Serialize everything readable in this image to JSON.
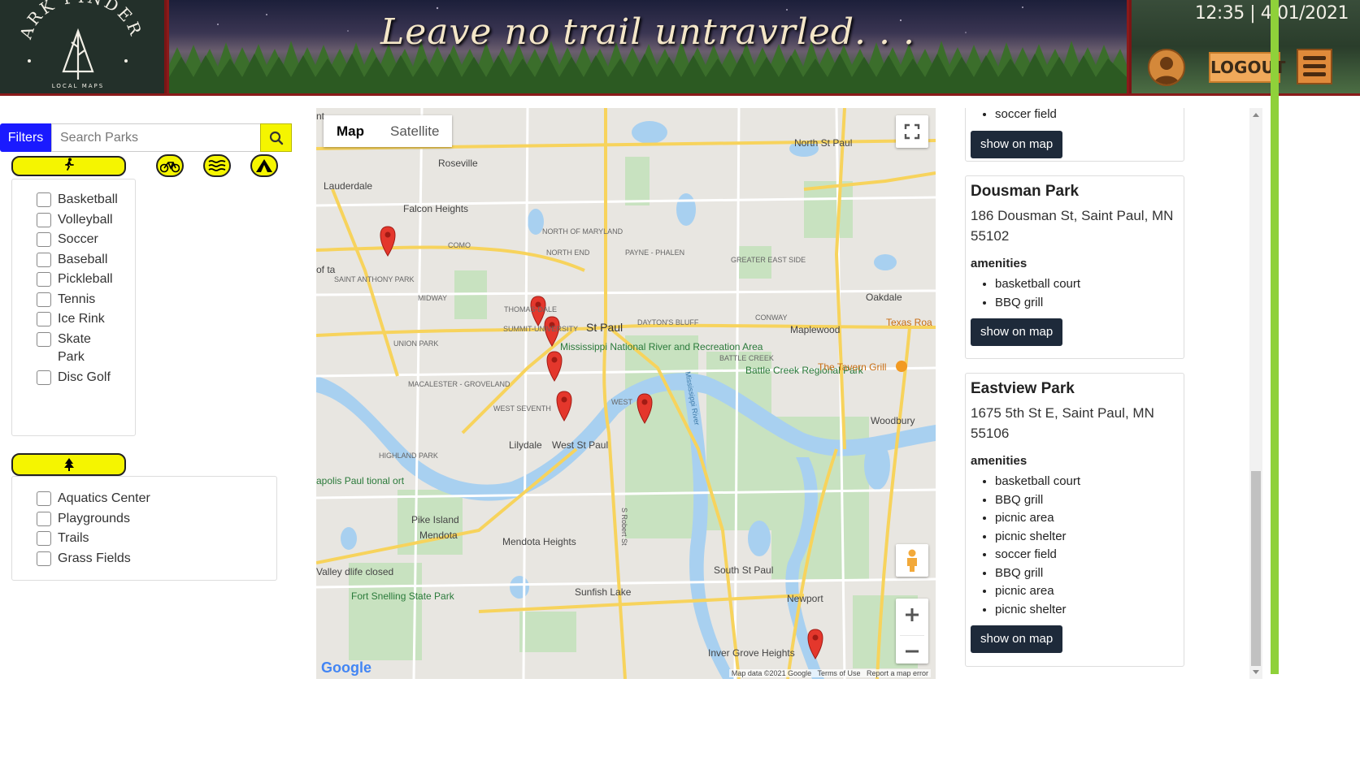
{
  "header": {
    "logo": {
      "title": "PARK FINDERS",
      "subtitle": "LOCAL MAPS",
      "icon": "tree-icon"
    },
    "tagline": "Leave no trail untravrled. . .",
    "clock": "12:35 | 4/01/2021",
    "logout_label": "LOGOUT",
    "avatar_icon": "user-avatar-icon",
    "menu_icon": "hamburger-menu-icon"
  },
  "sidebar": {
    "filters_label": "Filters",
    "search_placeholder": "Search Parks",
    "category_icons": [
      "walking-person-icon",
      "bicycle-icon",
      "water-waves-icon",
      "tent-icon",
      "pine-tree-icon"
    ],
    "sports": [
      {
        "label": "Basketball"
      },
      {
        "label": "Volleyball"
      },
      {
        "label": "Soccer"
      },
      {
        "label": "Baseball"
      },
      {
        "label": "Pickleball"
      },
      {
        "label": "Tennis"
      },
      {
        "label": "Ice Rink"
      },
      {
        "label": "Skate Park"
      },
      {
        "label": "Disc Golf"
      }
    ],
    "facilities": [
      {
        "label": "Aquatics Center"
      },
      {
        "label": "Playgrounds"
      },
      {
        "label": "Trails"
      },
      {
        "label": "Grass Fields"
      }
    ]
  },
  "map": {
    "type_map": "Map",
    "type_satellite": "Satellite",
    "attribution": "Map data ©2021 Google",
    "terms": "Terms of Use",
    "report": "Report a map error",
    "google": "Google",
    "places": {
      "roseville": "Roseville",
      "lauderdale": "Lauderdale",
      "falcon": "Falcon Heights",
      "como": "COMO",
      "north_maryland": "NORTH OF MARYLAND",
      "north_end": "NORTH END",
      "payne": "PAYNE - PHALEN",
      "greater_east": "GREATER EAST SIDE",
      "north_st_paul": "North St Paul",
      "oakdale": "Oakdale",
      "saint_anthony": "SAINT ANTHONY PARK",
      "midway": "MIDWAY",
      "thomas": "THOMAS-DALE",
      "summit": "SUMMIT-UNIVERSITY",
      "st_paul": "St Paul",
      "daytons": "DAYTON'S BLUFF",
      "conway": "CONWAY",
      "maplewood": "Maplewood",
      "texas": "Texas Roa",
      "union_park": "UNION PARK",
      "mississippi": "Mississippi National River and Recreation Area",
      "battle_creek": "BATTLE CREEK",
      "battle_creek_park": "Battle Creek Regional Park",
      "tavern": "The Tavern Grill",
      "macalester": "MACALESTER - GROVELAND",
      "west_seventh": "WEST SEVENTH",
      "west": "WEST",
      "woodbury": "Woodbury",
      "lilydale": "Lilydale",
      "west_st_paul": "West St Paul",
      "highland": "HIGHLAND PARK",
      "pike_island": "Pike Island",
      "mendota": "Mendota",
      "mendota_heights": "Mendota Heights",
      "south_st_paul": "South St Paul",
      "sunfish": "Sunfish Lake",
      "fort_snelling": "Fort Snelling State Park",
      "newport": "Newport",
      "inver_grove": "Inver Grove Heights",
      "mississippi_river": "Mississippi River",
      "robert_st": "S Robert St",
      "minneapolis_frag": "apolis Paul tional ort",
      "valley_frag": "Valley dlife closed",
      "ofta_frag": "of ta",
      "nt_frag": "nt"
    },
    "marker_icon": "map-marker-icon",
    "fullscreen_icon": "fullscreen-icon",
    "pegman_icon": "pegman-icon",
    "zoom_in_icon": "zoom-in-icon",
    "zoom_out_icon": "zoom-out-icon"
  },
  "results": {
    "cutoff_item": "soccer field",
    "show_label": "show on map",
    "amenities_label": "amenities",
    "parks": [
      {
        "name": "Dousman Park",
        "address": "186 Dousman St, Saint Paul, MN 55102",
        "amenities": [
          "basketball court",
          "BBQ grill"
        ]
      },
      {
        "name": "Eastview Park",
        "address": "1675 5th St E, Saint Paul, MN 55106",
        "amenities": [
          "basketball court",
          "BBQ grill",
          "picnic area",
          "picnic shelter",
          "soccer field",
          "BBQ grill",
          "picnic area",
          "picnic shelter"
        ]
      }
    ]
  }
}
